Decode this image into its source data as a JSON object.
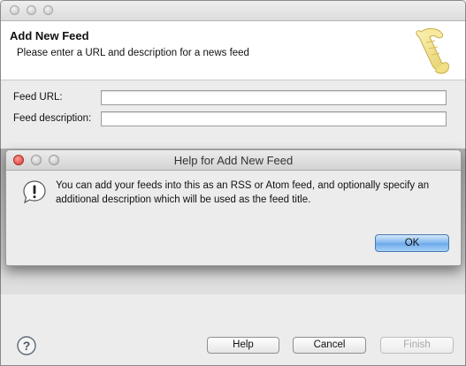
{
  "wizard": {
    "title": "Add New Feed",
    "description": "Please enter a URL and description for a news feed",
    "banner_icon": "scroll-icon",
    "fields": {
      "url_label": "Feed URL:",
      "url_value": "",
      "description_label": "Feed description:",
      "description_value": ""
    },
    "buttons": {
      "help": "Help",
      "cancel": "Cancel",
      "finish": "Finish"
    },
    "help_icon": "question-icon"
  },
  "help_dialog": {
    "title": "Help for Add New Feed",
    "message": "You can add your feeds into this as an RSS or Atom feed, and optionally specify an additional description which will be used as the feed title.",
    "ok": "OK",
    "icon": "warning-icon"
  },
  "colors": {
    "close_red": "#e0443e",
    "minimize_gray": "#c4c4c4",
    "default_button_blue": "#6ba9ea",
    "disabled_text": "#a8a8a8"
  }
}
